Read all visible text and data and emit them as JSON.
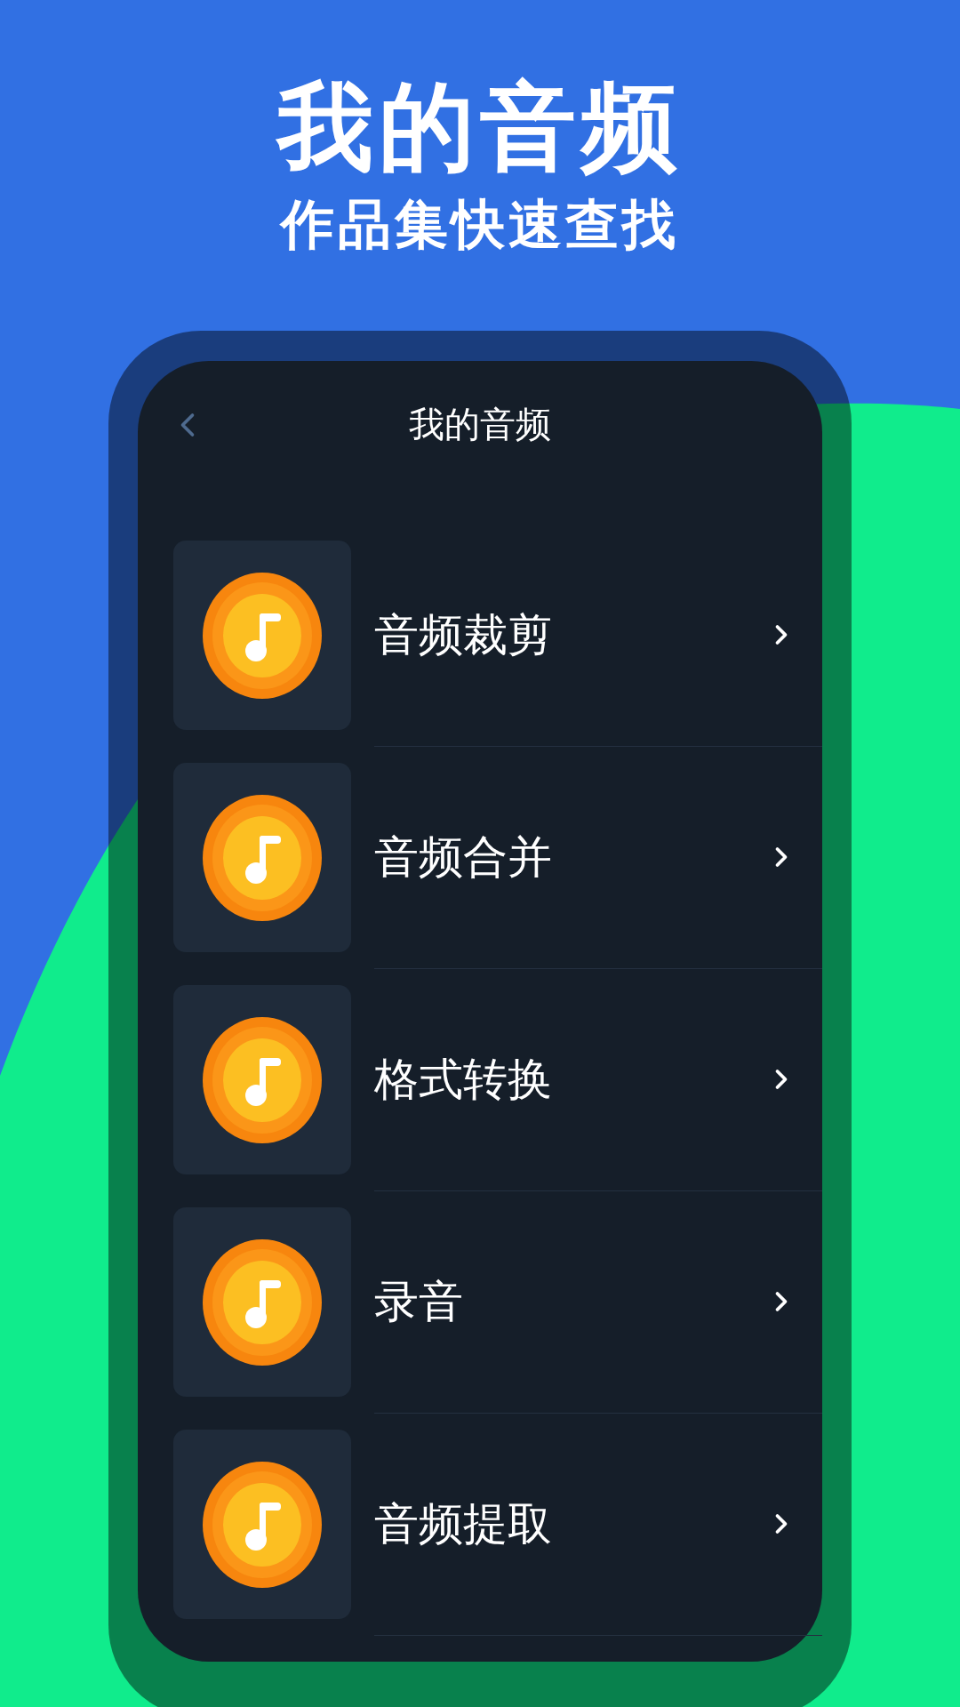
{
  "header": {
    "title": "我的音频",
    "subtitle": "作品集快速查找"
  },
  "screen": {
    "title": "我的音频",
    "items": [
      {
        "label": "音频裁剪"
      },
      {
        "label": "音频合并"
      },
      {
        "label": "格式转换"
      },
      {
        "label": "录音"
      },
      {
        "label": "音频提取"
      }
    ]
  }
}
